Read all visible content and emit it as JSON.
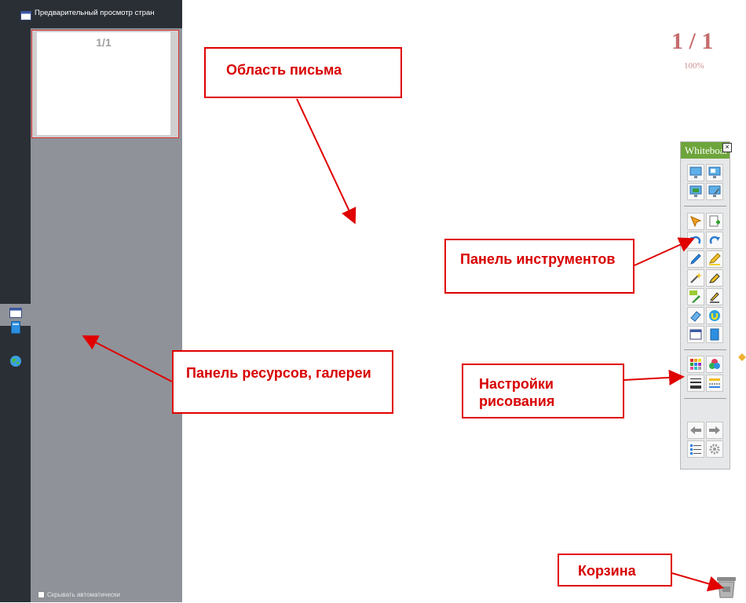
{
  "left_panel": {
    "title": "Предварительный просмотр стран",
    "thumbnail_label": "1/1",
    "autohide_label": "Скрывать автоматически",
    "tabs": [
      {
        "icon": "page-icon",
        "active": true
      },
      {
        "icon": "gallery-book-icon",
        "active": false
      },
      {
        "icon": "globe-icon",
        "active": false
      }
    ]
  },
  "page_indicator": {
    "page": "1 / 1",
    "zoom": "100%"
  },
  "toolbar": {
    "title": "Whiteboard"
  },
  "callouts": {
    "writing_area": "Область письма",
    "tools_panel": "Панель инструментов",
    "resources_panel": "Панель ресурсов, галереи",
    "drawing_settings": "Настройки рисования",
    "trash": "Корзина"
  },
  "colors": {
    "accent_red": "#e00000",
    "sidebar": "#2a2f36",
    "panel": "#8f9299",
    "toolbar_header": "#6ea53b"
  }
}
